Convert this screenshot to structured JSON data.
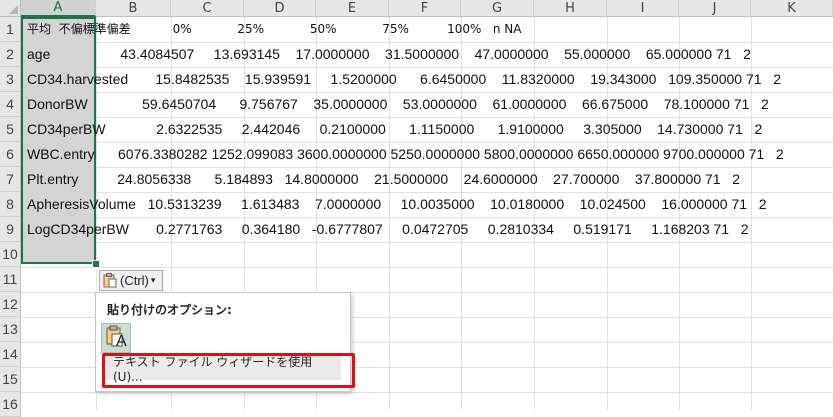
{
  "columns": [
    "A",
    "B",
    "C",
    "D",
    "E",
    "F",
    "G",
    "H",
    "I",
    "J",
    "K"
  ],
  "rows": [
    "1",
    "2",
    "3",
    "4",
    "5",
    "6",
    "7",
    "8",
    "9",
    "10",
    "11",
    "12",
    "13",
    "14",
    "15",
    "16"
  ],
  "cells": [
    "平均  不偏標準偏差           0%            25%            50%            75%          100%   n NA",
    "age                  43.4084507     13.693145    17.0000000    31.5000000    47.0000000    55.000000    65.000000 71   2",
    "CD34.harvested       15.8482535    15.939591     1.5200000      6.6450000    11.8320000    19.343000   109.350000 71   2",
    "DonorBW              59.6450704      9.756767    35.0000000    53.0000000    61.0000000    66.675000    78.100000 71   2",
    "CD34perBW             2.6322535     2.442046     0.2100000      1.1150000      1.9100000     3.305000    14.730000 71   2",
    "WBC.entry      6076.3380282 1252.099083 3600.0000000 5250.0000000 5800.0000000 6650.000000 9700.000000 71   2",
    "Plt.entry          24.8056338      5.184893   14.8000000    21.5000000    24.6000000    27.700000    37.800000 71   2",
    "ApheresisVolume   10.5313239     1.613483    7.0000000     10.0035000    10.0180000    10.024500    16.000000 71   2",
    "LogCD34perBW       0.2771763     0.364180   -0.6777807     0.0472705     0.2810334     0.519171     1.168203 71   2"
  ],
  "paste_button": {
    "label": "(Ctrl)",
    "caret": "▾"
  },
  "paste_menu": {
    "title": "貼り付けのオプション:",
    "keep_source_letter": "A",
    "text_wizard_label": "テキスト ファイル ウィザードを使用(U)..."
  },
  "colors": {
    "selection_border": "#217346",
    "highlight": "#e01010"
  }
}
